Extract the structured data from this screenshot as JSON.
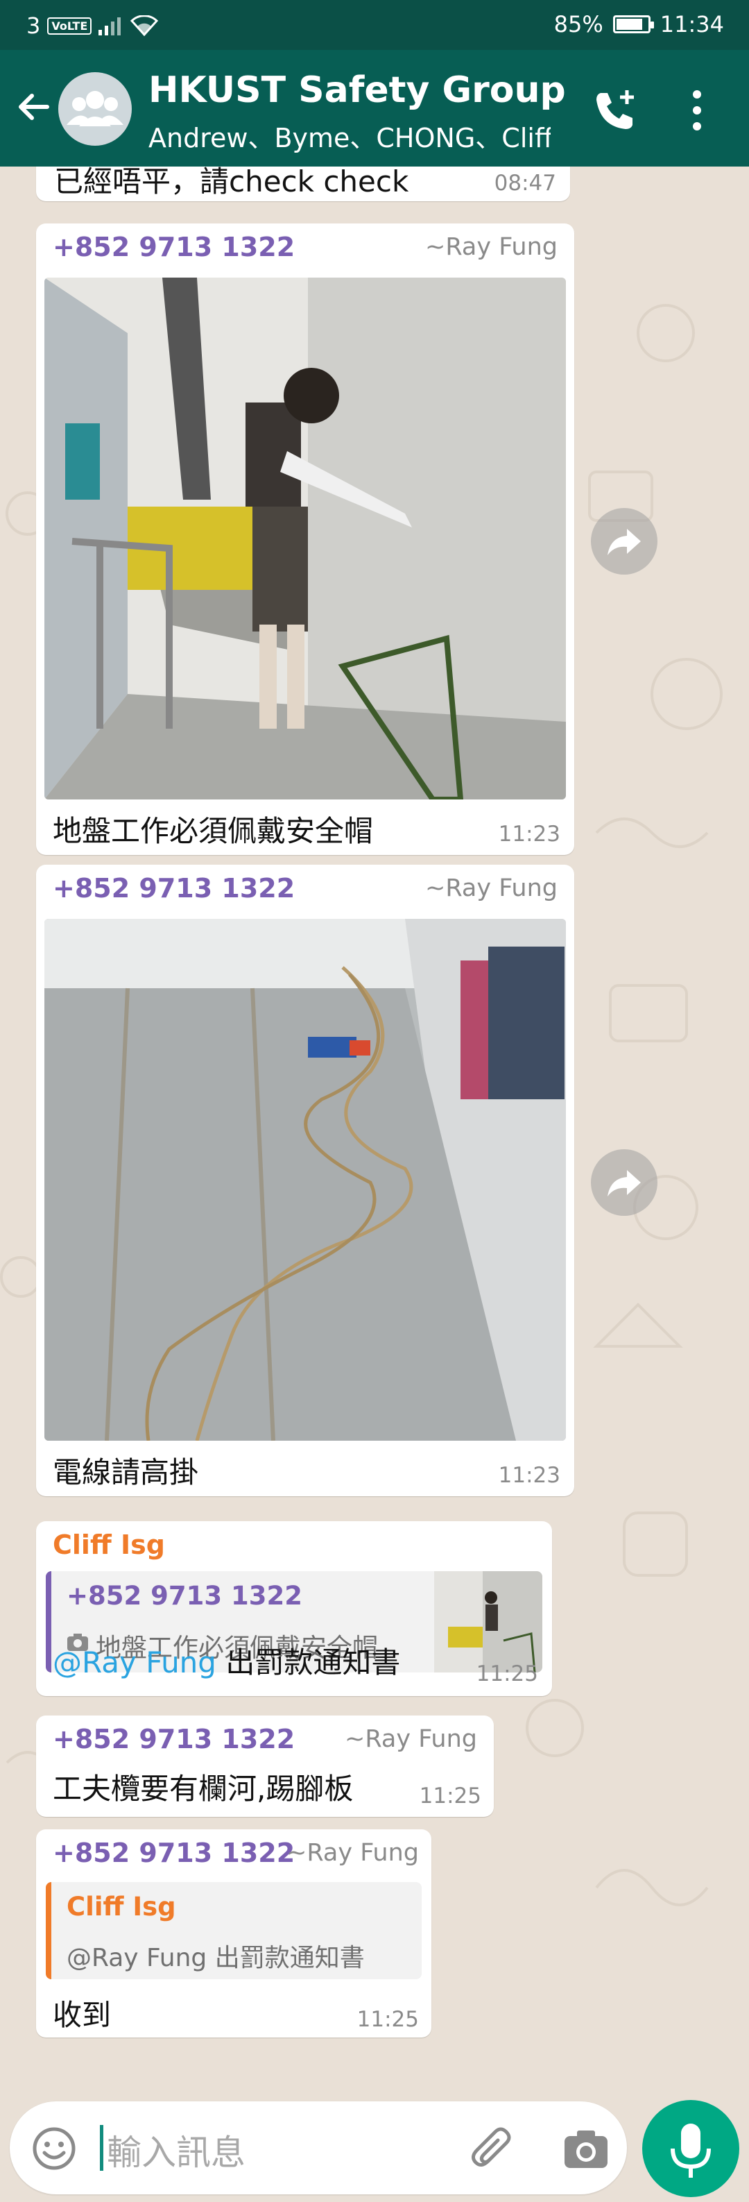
{
  "status_bar": {
    "carrier": "3",
    "network_badge": "VoLTE",
    "battery_percent": "85%",
    "battery_level": 0.85,
    "time": "11:34"
  },
  "header": {
    "title": "HKUST Safety Group",
    "members": "Andrew、Byme、CHONG、Cliff..."
  },
  "messages": [
    {
      "partial_text": "已經唔平，請check check",
      "time": "08:47"
    },
    {
      "sender": "+852 9713 1322",
      "alias": "~Ray Fung",
      "image": "photo-worker-plastering-wall",
      "caption": "地盤工作必須佩戴安全帽",
      "time": "11:23"
    },
    {
      "sender": "+852 9713 1322",
      "alias": "~Ray Fung",
      "image": "photo-cables-on-floor",
      "caption": "電線請高掛",
      "time": "11:23"
    },
    {
      "sender": "Cliff Isg",
      "quote": {
        "sender": "+852 9713 1322",
        "text": "地盤工作必須佩戴安全帽",
        "icon": "camera-icon"
      },
      "mention": "@Ray Fung",
      "text": " 出罰款通知書",
      "time": "11:25"
    },
    {
      "sender": "+852 9713 1322",
      "alias": "~Ray Fung",
      "text": "工夫欖要有欄河,踢腳板",
      "time": "11:25"
    },
    {
      "sender": "+852 9713 1322",
      "alias": "~Ray Fung",
      "quote": {
        "sender": "Cliff Isg",
        "text": "@Ray Fung 出罰款通知書"
      },
      "text": "收到",
      "time": "11:25"
    }
  ],
  "input": {
    "placeholder": "輸入訊息"
  },
  "colors": {
    "header": "#075e54",
    "status_bar": "#0b5047",
    "chat_background": "#e9e0d6",
    "sender_purple": "#7a5fb2",
    "sender_orange": "#f07b29",
    "mention_blue": "#2aa3e0",
    "mic_green": "#00a884"
  },
  "icons": [
    "back-arrow-icon",
    "group-avatar-icon",
    "add-call-icon",
    "more-options-icon",
    "forward-icon",
    "emoji-icon",
    "attach-icon",
    "camera-icon",
    "mic-icon"
  ]
}
